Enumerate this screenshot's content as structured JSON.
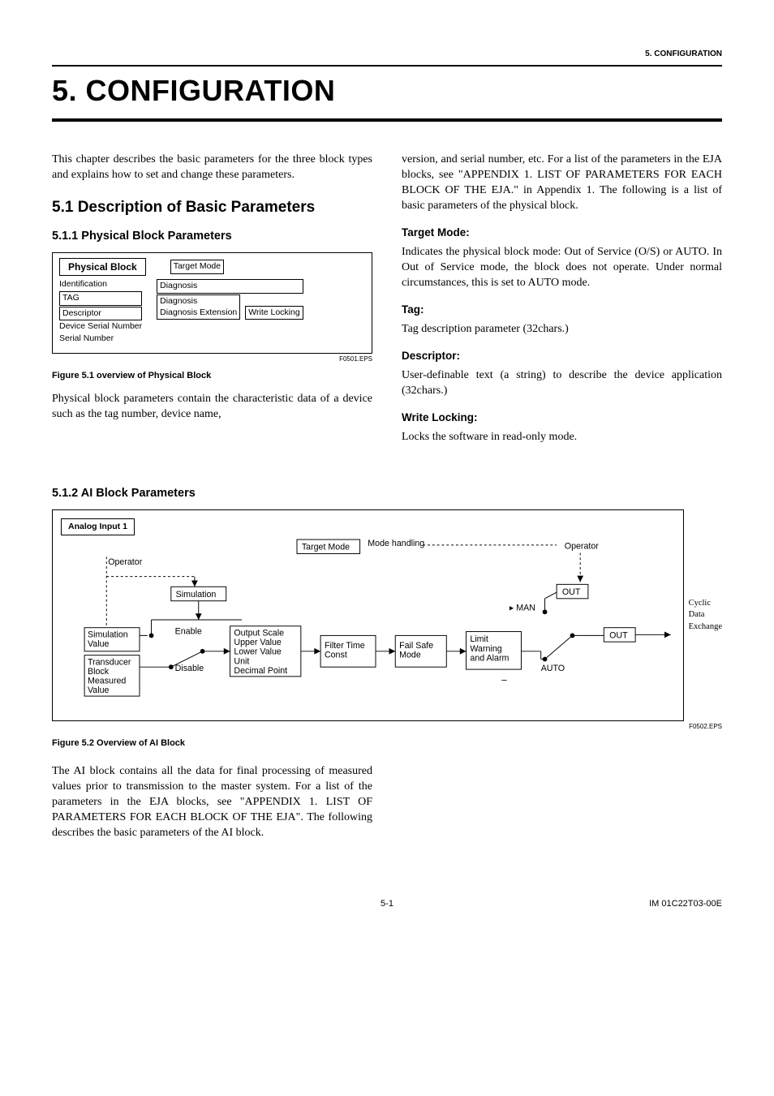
{
  "header": {
    "section_label": "5.  CONFIGURATION",
    "chapter_title": "5.    CONFIGURATION"
  },
  "intro_para": "This chapter describes the basic parameters for the three block types and explains how to set and change these parameters.",
  "s51_heading": "5.1 Description of Basic Parameters",
  "s511_heading": "5.1.1 Physical Block Parameters",
  "fig51": {
    "title": "Physical Block",
    "target_mode": "Target Mode",
    "identification": "Identification",
    "tag": "TAG",
    "descriptor": "Descriptor",
    "dsn": "Device Serial Number",
    "sn": "Serial Number",
    "diag": "Diagnosis",
    "diag_ext": "Diagnosis\nDiagnosis Extension",
    "write_locking": "Write Locking",
    "source": "F0501.EPS",
    "caption": "Figure 5.1 overview of Physical Block"
  },
  "physblock_para": "Physical block parameters contain the characteristic data of a device such as the tag number, device name, version, and serial number, etc. For a list of the parameters in the EJA blocks, see \"APPENDIX 1. LIST OF PARAMETERS FOR EACH BLOCK OF THE EJA.\" in Appendix 1. The following is a list of basic parameters of the physical block.",
  "physblock_para_left": "Physical block parameters contain the characteristic data of a device such as the tag number, device name,",
  "physblock_para_right": "version, and serial number, etc. For a list of the parameters in the EJA blocks, see \"APPENDIX 1. LIST OF PARAMETERS FOR EACH BLOCK OF THE EJA.\" in Appendix 1. The following is a list of basic parameters of the physical block.",
  "target_mode": {
    "h": "Target Mode:",
    "p": "Indicates the physical block mode: Out of Service (O/S) or AUTO. In Out of Service mode, the block does not operate. Under normal circumstances, this is set to AUTO mode."
  },
  "tag": {
    "h": "Tag:",
    "p": "Tag description parameter (32chars.)"
  },
  "descriptor": {
    "h": "Descriptor:",
    "p": "User-definable text (a string) to describe the device application (32chars.)"
  },
  "write_locking": {
    "h": "Write Locking:",
    "p": "Locks the software in read-only mode."
  },
  "s512_heading": "5.1.2 AI Block Parameters",
  "fig52": {
    "title": "Analog Input 1",
    "operator_top": "Operator",
    "target_mode": "Target Mode",
    "mode_handling": "Mode handling",
    "operator_right": "Operator",
    "simulation": "Simulation",
    "enable": "Enable",
    "disable": "Disable",
    "sim_value": "Simulation Value",
    "transducer": "Transducer Block Measured Value",
    "output_scale": "Output Scale\nUpper Value\nLower Value\nUnit\nDecimal Point",
    "filter": "Filter Time Const",
    "failsafe": "Fail Safe Mode",
    "limit": "Limit Warning and Alarm",
    "man": "MAN",
    "auto": "AUTO",
    "out1": "OUT",
    "out2": "OUT",
    "outside": "Cyclic Data Exchange",
    "dash": "–",
    "source": "F0502.EPS",
    "caption": "Figure 5.2 Overview of AI Block"
  },
  "ai_para": "The AI block contains all the data for final processing of measured values prior to transmission to the master system. For a list of the parameters in the EJA blocks, see \"APPENDIX 1.  LIST OF PARAMETERS FOR EACH BLOCK OF THE EJA\". The following describes the basic parameters of the AI block.",
  "footer": {
    "page": "5-1",
    "doc": "IM 01C22T03-00E"
  }
}
